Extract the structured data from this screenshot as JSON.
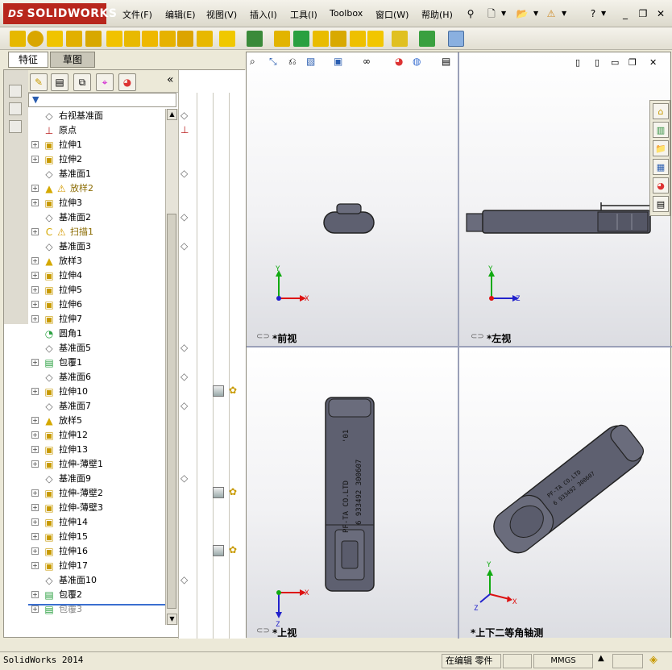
{
  "app": {
    "brand": "SOLIDWORKS",
    "brand_prefix": "DS"
  },
  "menu": [
    {
      "label": "文件(F)"
    },
    {
      "label": "编辑(E)"
    },
    {
      "label": "视图(V)"
    },
    {
      "label": "插入(I)"
    },
    {
      "label": "工具(I)"
    },
    {
      "label": "Toolbox"
    },
    {
      "label": "窗口(W)"
    },
    {
      "label": "帮助(H)"
    }
  ],
  "tabs": {
    "features": "特征",
    "sketch": "草图"
  },
  "panel": {
    "collapse": "«"
  },
  "tree": [
    {
      "label": "右视基准面",
      "icon": "plane-icon",
      "expand": false
    },
    {
      "label": "原点",
      "icon": "origin-icon",
      "expand": false
    },
    {
      "label": "拉伸1",
      "icon": "extrude-icon",
      "expand": true
    },
    {
      "label": "拉伸2",
      "icon": "extrude-icon",
      "expand": true
    },
    {
      "label": "基准面1",
      "icon": "plane-icon",
      "expand": false
    },
    {
      "label": "放样2",
      "icon": "loft-icon",
      "expand": true,
      "warn": true
    },
    {
      "label": "拉伸3",
      "icon": "extrude-icon",
      "expand": true
    },
    {
      "label": "基准面2",
      "icon": "plane-icon",
      "expand": false
    },
    {
      "label": "扫描1",
      "icon": "sweep-icon",
      "expand": true,
      "warn": true
    },
    {
      "label": "基准面3",
      "icon": "plane-icon",
      "expand": false
    },
    {
      "label": "放样3",
      "icon": "loft-icon",
      "expand": true
    },
    {
      "label": "拉伸4",
      "icon": "extrude-icon",
      "expand": true
    },
    {
      "label": "拉伸5",
      "icon": "extrude-icon",
      "expand": true
    },
    {
      "label": "拉伸6",
      "icon": "extrude-icon",
      "expand": true
    },
    {
      "label": "拉伸7",
      "icon": "extrude-icon",
      "expand": true
    },
    {
      "label": "圆角1",
      "icon": "fillet-icon",
      "expand": false
    },
    {
      "label": "基准面5",
      "icon": "plane-icon",
      "expand": false
    },
    {
      "label": "包覆1",
      "icon": "wrap-icon",
      "expand": true
    },
    {
      "label": "基准面6",
      "icon": "plane-icon",
      "expand": false
    },
    {
      "label": "拉伸10",
      "icon": "extrude-icon",
      "expand": true
    },
    {
      "label": "基准面7",
      "icon": "plane-icon",
      "expand": false
    },
    {
      "label": "放样5",
      "icon": "loft-icon",
      "expand": true
    },
    {
      "label": "拉伸12",
      "icon": "extrude-icon",
      "expand": true
    },
    {
      "label": "拉伸13",
      "icon": "extrude-icon",
      "expand": true
    },
    {
      "label": "拉伸-薄壁1",
      "icon": "extrude-icon",
      "expand": true
    },
    {
      "label": "基准面9",
      "icon": "plane-icon",
      "expand": false
    },
    {
      "label": "拉伸-薄壁2",
      "icon": "extrude-icon",
      "expand": true
    },
    {
      "label": "拉伸-薄壁3",
      "icon": "extrude-icon",
      "expand": true
    },
    {
      "label": "拉伸14",
      "icon": "extrude-icon",
      "expand": true
    },
    {
      "label": "拉伸15",
      "icon": "extrude-icon",
      "expand": true
    },
    {
      "label": "拉伸16",
      "icon": "extrude-icon",
      "expand": true
    },
    {
      "label": "拉伸17",
      "icon": "extrude-icon",
      "expand": true
    },
    {
      "label": "基准面10",
      "icon": "plane-icon",
      "expand": false
    },
    {
      "label": "包覆2",
      "icon": "wrap-icon",
      "expand": true
    },
    {
      "label": "包覆3",
      "icon": "wrap-icon",
      "expand": true,
      "dim": true
    }
  ],
  "views": {
    "front": "*前视",
    "left": "*左视",
    "top": "*上视",
    "iso": "*上下二等角轴测"
  },
  "axes": {
    "x": "X",
    "y": "Y",
    "z": "Z"
  },
  "part_text": {
    "line1": "PF-TA CO.LTD",
    "line2": "6 933492 300607",
    "line3": "'01"
  },
  "status": {
    "app_version": "SolidWorks 2014",
    "mode": "在编辑 零件",
    "units": "MMGS"
  },
  "colors": {
    "brand": "#b8261c",
    "axis_x": "#d11",
    "axis_y": "#1a1",
    "axis_z": "#22c",
    "part": "#5e6070"
  }
}
